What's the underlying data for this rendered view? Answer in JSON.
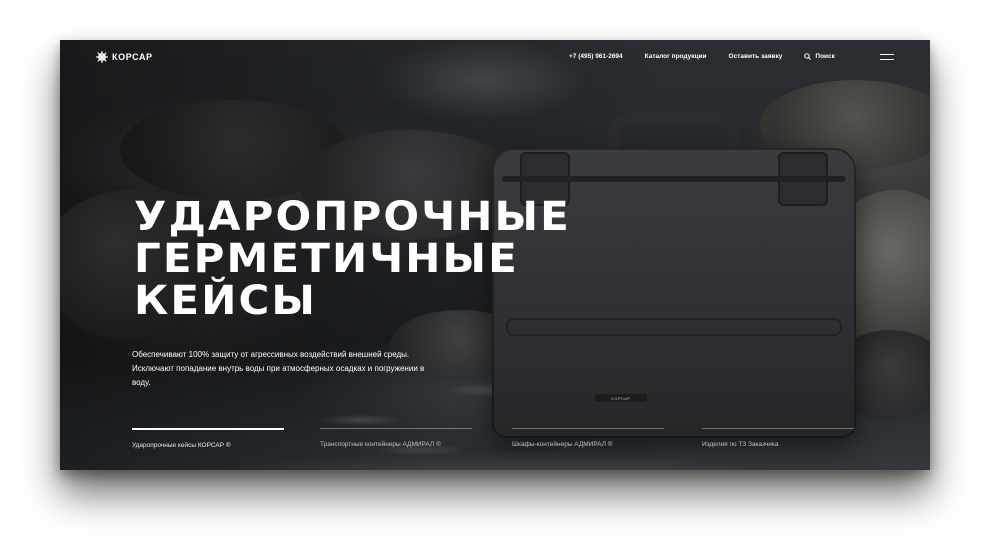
{
  "brand": {
    "name": "КОРСАР"
  },
  "nav": {
    "phone": "+7 (495) 961-2694",
    "catalog": "Каталог продукции",
    "request": "Оставить заявку",
    "search": "Поиск"
  },
  "hero": {
    "title_lines": [
      "УДАРОПРОЧНЫЕ",
      "ГЕРМЕТИЧНЫЕ",
      "КЕЙСЫ"
    ],
    "description": "Обеспечивают 100% защиту от агрессивных воздействий внешней среды. Исключают попадание внутрь воды при атмосферных осадках и погружении в воду.",
    "case_label": "КОРСАР"
  },
  "tabs": [
    {
      "label": "Ударопрочные кейсы КОРСАР ®",
      "active": true
    },
    {
      "label": "Транспортные контейнеры АДМИРАЛ ®",
      "active": false
    },
    {
      "label": "Шкафы-контейнеры АДМИРАЛ ®",
      "active": false
    },
    {
      "label": "Изделия по ТЗ Заказчика",
      "active": false
    }
  ],
  "icons": {
    "logo": "ship-wheel-icon",
    "search": "search-icon",
    "menu": "hamburger-menu-icon"
  },
  "colors": {
    "text": "#ffffff",
    "background": "#1d2023"
  }
}
